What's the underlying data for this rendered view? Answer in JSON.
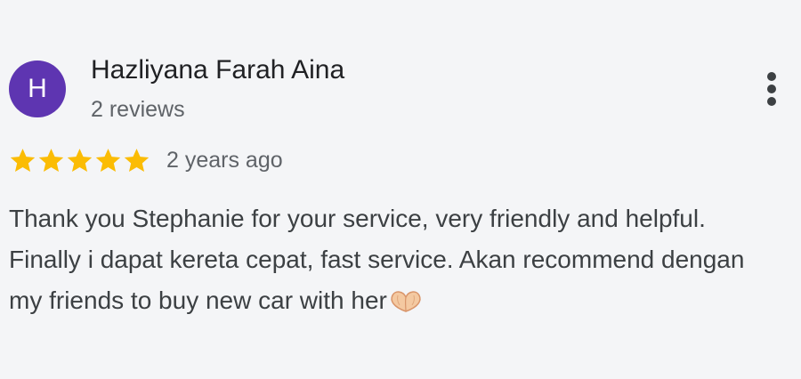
{
  "review": {
    "author": {
      "initial": "H",
      "name": "Hazliyana Farah Aina",
      "reviews_count": "2 reviews",
      "avatar_color": "#5e35b1"
    },
    "rating": 5,
    "rating_max": 5,
    "star_color": "#fbbc04",
    "time_ago": "2 years ago",
    "text": "Thank you Stephanie for your service, very friendly and helpful. Finally i dapat kereta cepat, fast service. Akan recommend dengan my friends to buy new car with her",
    "trailing_emoji": "heart-hands-emoji",
    "more_icon": "more-vertical-icon"
  }
}
